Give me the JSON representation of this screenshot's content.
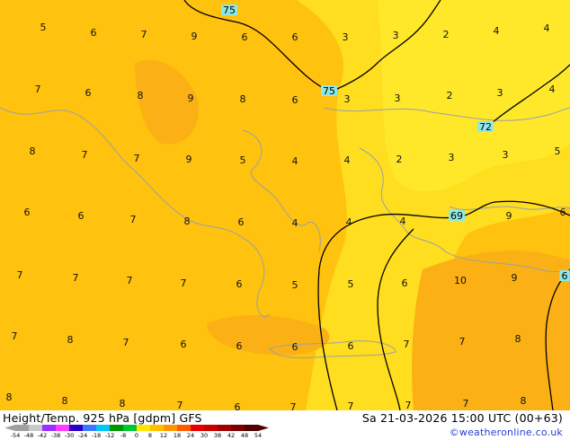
{
  "map": {
    "colors": {
      "base": "#ffc20e",
      "warm": "#fbb115",
      "light": "#ffde1f",
      "lighter": "#ffe82a",
      "coast": "#9aa0aa",
      "contour": "#000000"
    },
    "contour_labels": [
      "75",
      "75",
      "72",
      "69",
      "6"
    ],
    "temp_labels": [
      "5",
      "6",
      "7",
      "9",
      "6",
      "6",
      "3",
      "3",
      "2",
      "4",
      "4",
      "7",
      "6",
      "8",
      "9",
      "8",
      "6",
      "3",
      "3",
      "2",
      "3",
      "4",
      "8",
      "7",
      "7",
      "9",
      "5",
      "4",
      "4",
      "2",
      "3",
      "3",
      "5",
      "6",
      "6",
      "7",
      "8",
      "6",
      "4",
      "4",
      "4",
      "9",
      "6",
      "7",
      "7",
      "7",
      "7",
      "6",
      "5",
      "5",
      "6",
      "10",
      "9",
      "6",
      "7",
      "8",
      "7",
      "6",
      "6",
      "6",
      "6",
      "7",
      "7",
      "8",
      "8",
      "8",
      "8",
      "7",
      "6",
      "7",
      "7",
      "7",
      "7",
      "8"
    ]
  },
  "footer": {
    "title": "Height/Temp. 925 hPa [gdpm] GFS",
    "datetime": "Sa 21-03-2026 15:00 UTC (00+63)",
    "credit": "©weatheronline.co.uk",
    "legend_ticks": [
      "-54",
      "-48",
      "-42",
      "-38",
      "-30",
      "-24",
      "-18",
      "-12",
      "-8",
      "0",
      "8",
      "12",
      "18",
      "24",
      "30",
      "38",
      "42",
      "48",
      "54"
    ],
    "legend_colors": [
      "#a0a0a0",
      "#c8c8c8",
      "#9b30ff",
      "#ff3cff",
      "#2a00c8",
      "#3c78ff",
      "#00c8ff",
      "#009600",
      "#00c832",
      "#ffe600",
      "#ffbe00",
      "#ff9600",
      "#ff5a00",
      "#e60000",
      "#c80000",
      "#a00000",
      "#780000",
      "#500000"
    ]
  }
}
